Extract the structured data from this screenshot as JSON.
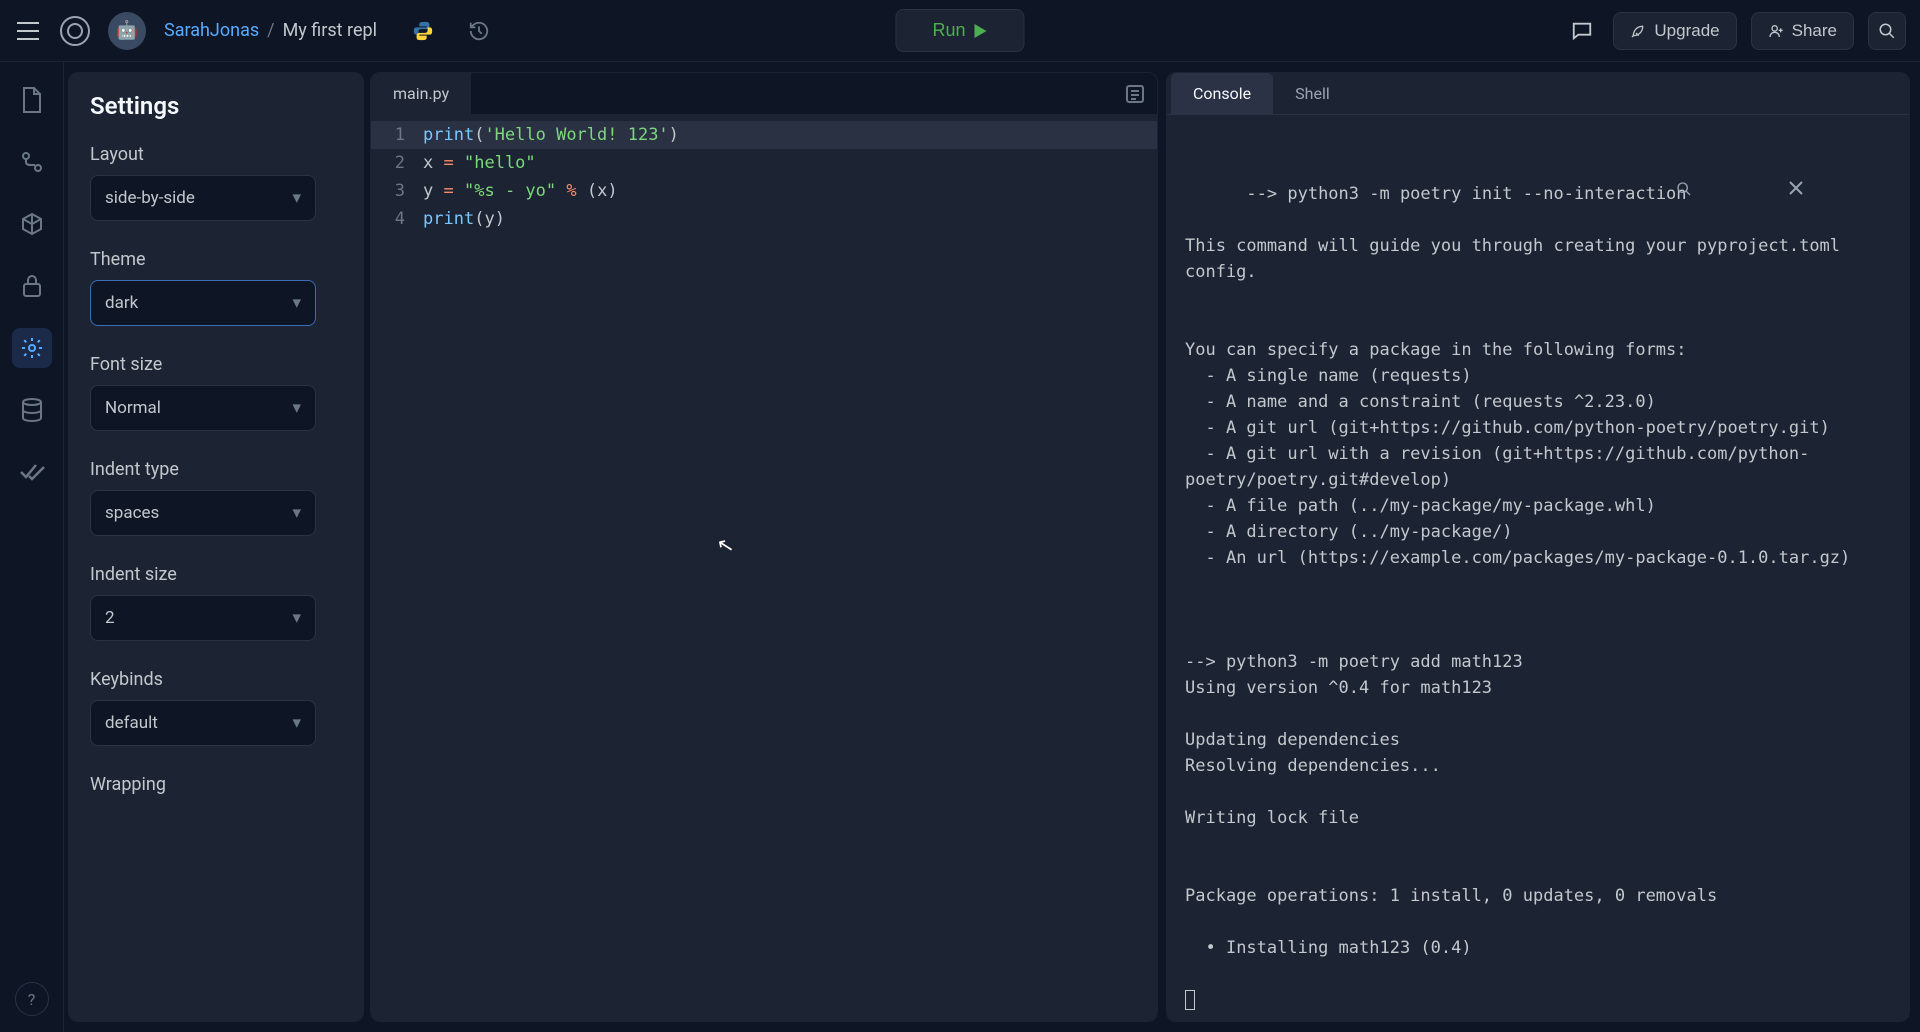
{
  "header": {
    "user": "SarahJonas",
    "separator": "/",
    "repl_name": "My first repl",
    "language": "python",
    "run_label": "Run",
    "upgrade_label": "Upgrade",
    "share_label": "Share"
  },
  "sidebar_rail": {
    "items": [
      "files",
      "version-control",
      "packages",
      "secrets",
      "settings",
      "database",
      "checkmarks"
    ],
    "active": "settings",
    "help": "?"
  },
  "settings": {
    "title": "Settings",
    "layout": {
      "label": "Layout",
      "value": "side-by-side"
    },
    "theme": {
      "label": "Theme",
      "value": "dark"
    },
    "font_size": {
      "label": "Font size",
      "value": "Normal"
    },
    "indent_type": {
      "label": "Indent type",
      "value": "spaces"
    },
    "indent_size": {
      "label": "Indent size",
      "value": "2"
    },
    "keybinds": {
      "label": "Keybinds",
      "value": "default"
    },
    "wrapping": {
      "label": "Wrapping"
    }
  },
  "editor": {
    "tab_name": "main.py",
    "lines": [
      {
        "n": 1,
        "html": "<span class='tok-fn'>print</span><span class='tok-punc'>(</span><span class='tok-str'>'Hello World! 123'</span><span class='tok-punc'>)</span>"
      },
      {
        "n": 2,
        "html": "<span class='tok-var'>x</span> <span class='tok-op'>=</span> <span class='tok-str'>\"hello\"</span>"
      },
      {
        "n": 3,
        "html": "<span class='tok-var'>y</span> <span class='tok-op'>=</span> <span class='tok-str'>\"%s - yo\"</span> <span class='tok-op'>%</span> <span class='tok-punc'>(</span><span class='tok-var'>x</span><span class='tok-punc'>)</span>"
      },
      {
        "n": 4,
        "html": "<span class='tok-fn'>print</span><span class='tok-punc'>(</span><span class='tok-var'>y</span><span class='tok-punc'>)</span>"
      }
    ]
  },
  "console": {
    "tabs": {
      "console": "Console",
      "shell": "Shell"
    },
    "active_tab": "console",
    "output": "--> python3 -m poetry init --no-interaction\n\nThis command will guide you through creating your pyproject.toml config.\n\n\nYou can specify a package in the following forms:\n  - A single name (requests)\n  - A name and a constraint (requests ^2.23.0)\n  - A git url (git+https://github.com/python-poetry/poetry.git)\n  - A git url with a revision (git+https://github.com/python-poetry/poetry.git#develop)\n  - A file path (../my-package/my-package.whl)\n  - A directory (../my-package/)\n  - An url (https://example.com/packages/my-package-0.1.0.tar.gz)\n\n\n\n--> python3 -m poetry add math123\nUsing version ^0.4 for math123\n\nUpdating dependencies\nResolving dependencies...\n\nWriting lock file\n\n\nPackage operations: 1 install, 0 updates, 0 removals\n\n  • Installing math123 (0.4)"
  }
}
